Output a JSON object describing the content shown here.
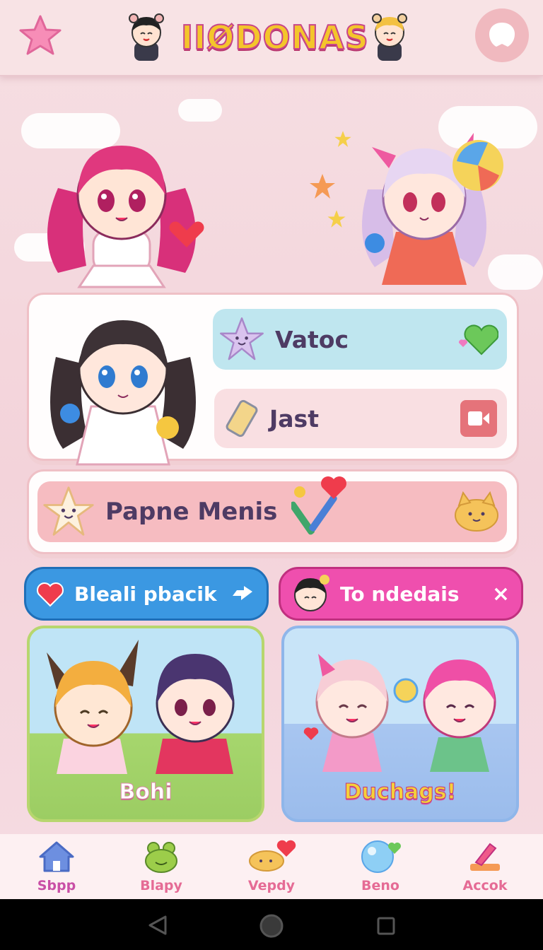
{
  "header": {
    "logo": "IIØDONAS",
    "star_icon": "star-icon",
    "profile_icon": "chat-bubble-icon"
  },
  "menu": {
    "item1": {
      "label": "Vatoc",
      "icon": "smiling-star-icon",
      "trail_icon": "green-heart-icon"
    },
    "item2": {
      "label": "Jast",
      "icon": "phone-icon",
      "trail_icon": "video-icon"
    }
  },
  "banner": {
    "label": "Papne Menis",
    "icon": "star-face-icon",
    "decor": "utensils-heart-icon",
    "trail_icon": "cat-face-icon"
  },
  "tabs": [
    {
      "label": "Bleali pbacik",
      "color": "#3b98e2",
      "icon": "heart-icon",
      "trail": "arrow-icon"
    },
    {
      "label": "To ndedais",
      "color": "#ef4fae",
      "icon": "avatar-icon",
      "trail": "×"
    }
  ],
  "tiles": [
    {
      "label": "Bohi"
    },
    {
      "label": "Duchags!"
    }
  ],
  "nav": [
    {
      "label": "Sbpp",
      "icon": "house-icon",
      "color": "#c94fa6"
    },
    {
      "label": "Blapy",
      "icon": "frog-icon",
      "color": "#e56b95"
    },
    {
      "label": "Vepdy",
      "icon": "cat-heart-icon",
      "color": "#e56b95"
    },
    {
      "label": "Beno",
      "icon": "bubble-icon",
      "color": "#e56b95"
    },
    {
      "label": "Accok",
      "icon": "pencil-icon",
      "color": "#e56b95"
    }
  ]
}
